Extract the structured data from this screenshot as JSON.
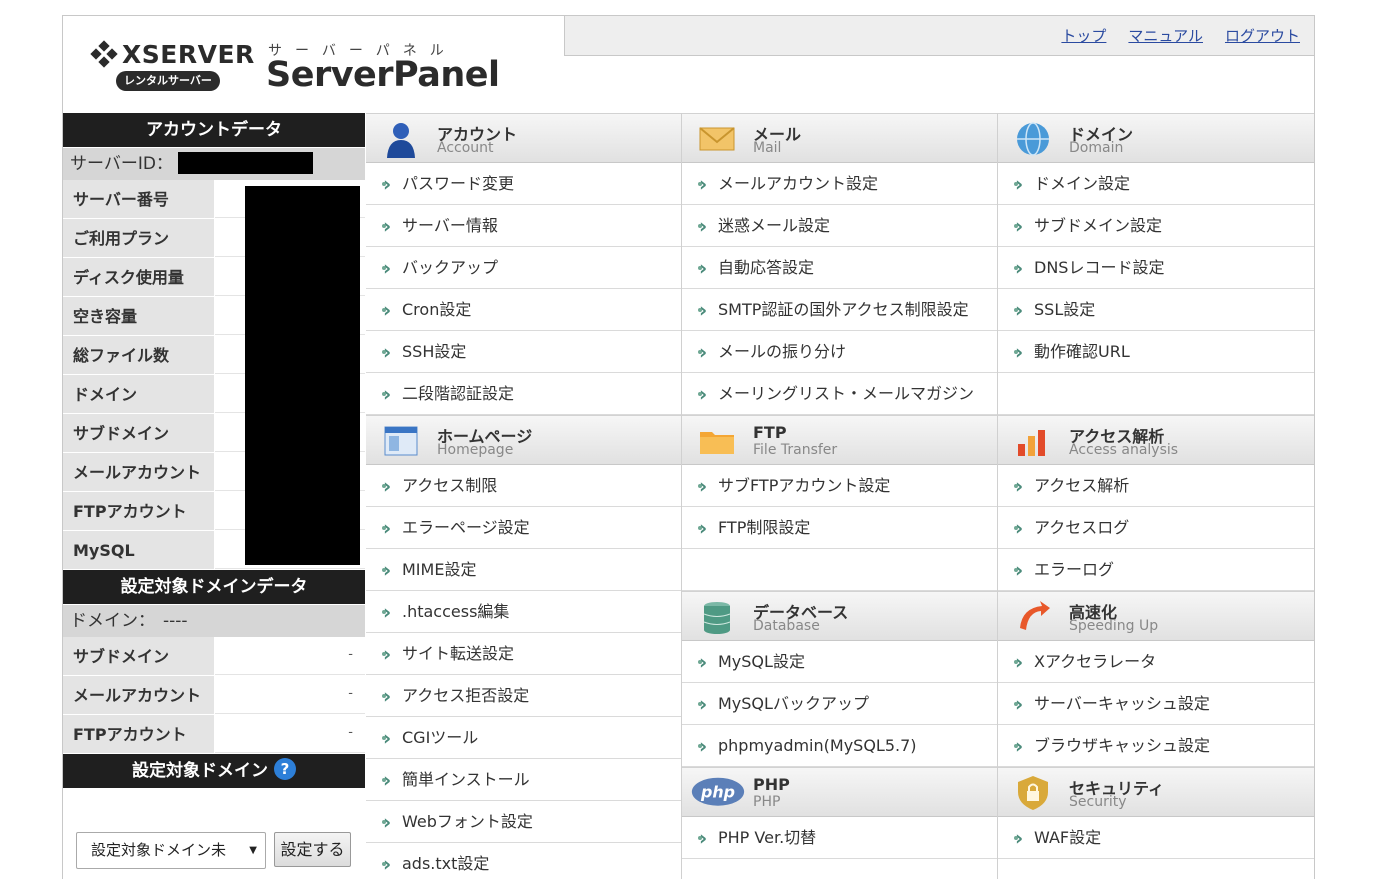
{
  "brand": {
    "xserver": "XSERVER",
    "badge": "レンタルサーバー",
    "kana": "サーバーパネル",
    "product": "ServerPanel"
  },
  "topnav": [
    "トップ",
    "マニュアル",
    "ログアウト"
  ],
  "account": {
    "heading": "アカウントデータ",
    "server_id_label": "サーバーID：",
    "rows": [
      "サーバー番号",
      "ご利用プラン",
      "ディスク使用量",
      "空き容量",
      "総ファイル数",
      "ドメイン",
      "サブドメイン",
      "メールアカウント",
      "FTPアカウント",
      "MySQL"
    ]
  },
  "target": {
    "heading": "設定対象ドメインデータ",
    "domain_label": "ドメイン：",
    "domain_value": "----",
    "rows": [
      {
        "k": "サブドメイン",
        "v": "-"
      },
      {
        "k": "メールアカウント",
        "v": "-"
      },
      {
        "k": "FTPアカウント",
        "v": "-"
      }
    ]
  },
  "domain_selector": {
    "heading": "設定対象ドメイン",
    "help": "?",
    "select_value": "設定対象ドメイン未",
    "button": "設定する"
  },
  "columns": [
    [
      {
        "jp": "アカウント",
        "en": "Account",
        "icon": "account-icon",
        "items": [
          "パスワード変更",
          "サーバー情報",
          "バックアップ",
          "Cron設定",
          "SSH設定",
          "二段階認証設定"
        ]
      },
      {
        "jp": "ホームページ",
        "en": "Homepage",
        "icon": "homepage-icon",
        "items": [
          "アクセス制限",
          "エラーページ設定",
          "MIME設定",
          ".htaccess編集",
          "サイト転送設定",
          "アクセス拒否設定",
          "CGIツール",
          "簡単インストール",
          "Webフォント設定",
          "ads.txt設定"
        ]
      }
    ],
    [
      {
        "jp": "メール",
        "en": "Mail",
        "icon": "mail-icon",
        "items": [
          "メールアカウント設定",
          "迷惑メール設定",
          "自動応答設定",
          "SMTP認証の国外アクセス制限設定",
          "メールの振り分け",
          "メーリングリスト・メールマガジン"
        ]
      },
      {
        "jp": "FTP",
        "en": "File Transfer",
        "icon": "folder-icon",
        "items": [
          "サブFTPアカウント設定",
          "FTP制限設定"
        ],
        "blank": 1
      },
      {
        "jp": "データベース",
        "en": "Database",
        "icon": "database-icon",
        "items": [
          "MySQL設定",
          "MySQLバックアップ",
          "phpmyadmin(MySQL5.7)"
        ]
      },
      {
        "jp": "PHP",
        "en": "PHP",
        "icon": "php-icon",
        "items": [
          "PHP Ver.切替"
        ]
      }
    ],
    [
      {
        "jp": "ドメイン",
        "en": "Domain",
        "icon": "globe-icon",
        "items": [
          "ドメイン設定",
          "サブドメイン設定",
          "DNSレコード設定",
          "SSL設定",
          "動作確認URL"
        ],
        "blank": 1
      },
      {
        "jp": "アクセス解析",
        "en": "Access analysis",
        "icon": "chart-icon",
        "items": [
          "アクセス解析",
          "アクセスログ",
          "エラーログ"
        ]
      },
      {
        "jp": "高速化",
        "en": "Speeding Up",
        "icon": "speed-icon",
        "items": [
          "Xアクセラレータ",
          "サーバーキャッシュ設定",
          "ブラウザキャッシュ設定"
        ]
      },
      {
        "jp": "セキュリティ",
        "en": "Security",
        "icon": "lock-icon",
        "items": [
          "WAF設定"
        ]
      }
    ]
  ]
}
